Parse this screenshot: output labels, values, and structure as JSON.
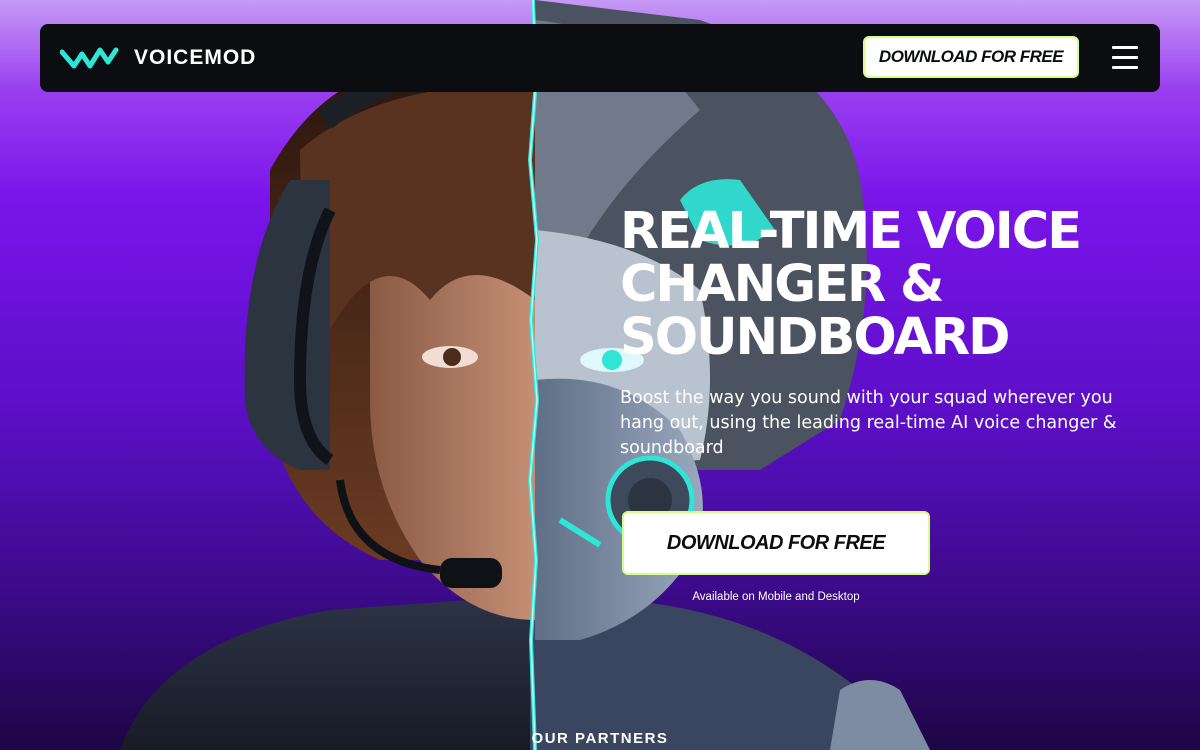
{
  "brand": {
    "name": "VOICEMOD",
    "accent": "#2ee6d6",
    "highlight": "#d6ff8a"
  },
  "nav": {
    "download_label": "DOWNLOAD FOR FREE",
    "menu_icon": "hamburger-menu-icon"
  },
  "hero": {
    "headline_lines": [
      "REAL-TIME VOICE",
      "CHANGER &",
      "SOUNDBOARD"
    ],
    "subtitle": "Boost the way you sound with your squad wherever you hang out, using the leading real-time AI voice changer & soundboard",
    "cta_label": "DOWNLOAD FOR FREE",
    "availability": "Available on Mobile and Desktop"
  },
  "partners_heading": "OUR PARTNERS"
}
